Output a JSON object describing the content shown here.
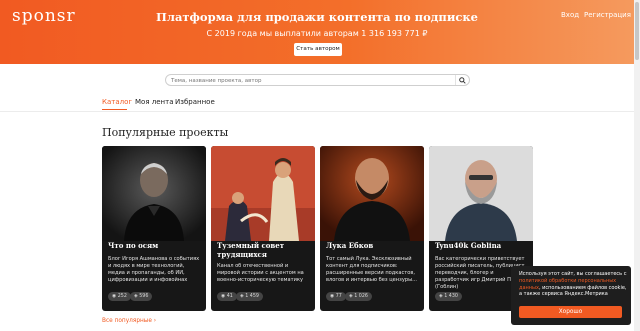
{
  "header": {
    "logo": "sponsr",
    "title": "Платформа для продажи контента по подписке",
    "subtitle": "С 2019 года мы выплатили авторам 1 316 193 771 ₽",
    "become_author": "Стать автором",
    "login": "Вход",
    "register": "Регистрация"
  },
  "search": {
    "placeholder": "Тема, название проекта, автор",
    "icon": "search-icon"
  },
  "tabs": [
    {
      "label": "Каталог",
      "active": true
    },
    {
      "label": "Моя лента",
      "active": false
    },
    {
      "label": "Избранное",
      "active": false
    }
  ],
  "section": {
    "title": "Популярные проекты",
    "all_link": "Все популярные"
  },
  "cards": [
    {
      "title": "Что по осям",
      "description": "Блог Игоря Ашманова о событиях и людях в мире технологий, медиа и пропаганды, об ИИ, цифровизации и инфовойнах",
      "subscribers": "252",
      "posts": "596"
    },
    {
      "title": "Туземный совет трудящихся",
      "description": "Канал об отечественной и мировой истории с акцентом на военно-историческую тематику",
      "subscribers": "41",
      "posts": "1 459"
    },
    {
      "title": "Лука Ебков",
      "description": "Тот самый Лука. Эксклюзивный контент для подписчиков: расширенные версии подкастов, влогов и интервью без цензуры...",
      "subscribers": "77",
      "posts": "1 026"
    },
    {
      "title": "Tynu40k Goblina",
      "description": "Вас категорически приветствует российский писатель, публицист, переводчик, блогер и разработчик игр Дмитрий Пучков (Гоблин)",
      "subscribers": "",
      "posts": "1 430"
    }
  ],
  "cookie": {
    "text_before": "Используя этот сайт, вы соглашаетесь с ",
    "link_text": "политикой обработки персональных данных",
    "text_after": ", использованием файлов cookie, а также сервиса Яндекс.Метрика",
    "accept": "Хорошо"
  },
  "colors": {
    "brand": "#f15a22",
    "card_bg": "#171717",
    "cookie_bg": "#1e1e1e"
  }
}
